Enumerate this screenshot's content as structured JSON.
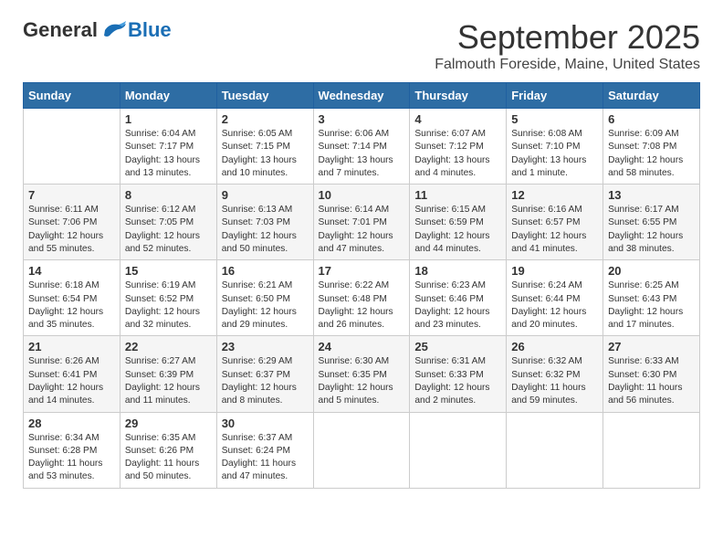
{
  "logo": {
    "general": "General",
    "blue": "Blue"
  },
  "title": "September 2025",
  "subtitle": "Falmouth Foreside, Maine, United States",
  "weekdays": [
    "Sunday",
    "Monday",
    "Tuesday",
    "Wednesday",
    "Thursday",
    "Friday",
    "Saturday"
  ],
  "weeks": [
    [
      {
        "day": "",
        "info": ""
      },
      {
        "day": "1",
        "info": "Sunrise: 6:04 AM\nSunset: 7:17 PM\nDaylight: 13 hours\nand 13 minutes."
      },
      {
        "day": "2",
        "info": "Sunrise: 6:05 AM\nSunset: 7:15 PM\nDaylight: 13 hours\nand 10 minutes."
      },
      {
        "day": "3",
        "info": "Sunrise: 6:06 AM\nSunset: 7:14 PM\nDaylight: 13 hours\nand 7 minutes."
      },
      {
        "day": "4",
        "info": "Sunrise: 6:07 AM\nSunset: 7:12 PM\nDaylight: 13 hours\nand 4 minutes."
      },
      {
        "day": "5",
        "info": "Sunrise: 6:08 AM\nSunset: 7:10 PM\nDaylight: 13 hours\nand 1 minute."
      },
      {
        "day": "6",
        "info": "Sunrise: 6:09 AM\nSunset: 7:08 PM\nDaylight: 12 hours\nand 58 minutes."
      }
    ],
    [
      {
        "day": "7",
        "info": "Sunrise: 6:11 AM\nSunset: 7:06 PM\nDaylight: 12 hours\nand 55 minutes."
      },
      {
        "day": "8",
        "info": "Sunrise: 6:12 AM\nSunset: 7:05 PM\nDaylight: 12 hours\nand 52 minutes."
      },
      {
        "day": "9",
        "info": "Sunrise: 6:13 AM\nSunset: 7:03 PM\nDaylight: 12 hours\nand 50 minutes."
      },
      {
        "day": "10",
        "info": "Sunrise: 6:14 AM\nSunset: 7:01 PM\nDaylight: 12 hours\nand 47 minutes."
      },
      {
        "day": "11",
        "info": "Sunrise: 6:15 AM\nSunset: 6:59 PM\nDaylight: 12 hours\nand 44 minutes."
      },
      {
        "day": "12",
        "info": "Sunrise: 6:16 AM\nSunset: 6:57 PM\nDaylight: 12 hours\nand 41 minutes."
      },
      {
        "day": "13",
        "info": "Sunrise: 6:17 AM\nSunset: 6:55 PM\nDaylight: 12 hours\nand 38 minutes."
      }
    ],
    [
      {
        "day": "14",
        "info": "Sunrise: 6:18 AM\nSunset: 6:54 PM\nDaylight: 12 hours\nand 35 minutes."
      },
      {
        "day": "15",
        "info": "Sunrise: 6:19 AM\nSunset: 6:52 PM\nDaylight: 12 hours\nand 32 minutes."
      },
      {
        "day": "16",
        "info": "Sunrise: 6:21 AM\nSunset: 6:50 PM\nDaylight: 12 hours\nand 29 minutes."
      },
      {
        "day": "17",
        "info": "Sunrise: 6:22 AM\nSunset: 6:48 PM\nDaylight: 12 hours\nand 26 minutes."
      },
      {
        "day": "18",
        "info": "Sunrise: 6:23 AM\nSunset: 6:46 PM\nDaylight: 12 hours\nand 23 minutes."
      },
      {
        "day": "19",
        "info": "Sunrise: 6:24 AM\nSunset: 6:44 PM\nDaylight: 12 hours\nand 20 minutes."
      },
      {
        "day": "20",
        "info": "Sunrise: 6:25 AM\nSunset: 6:43 PM\nDaylight: 12 hours\nand 17 minutes."
      }
    ],
    [
      {
        "day": "21",
        "info": "Sunrise: 6:26 AM\nSunset: 6:41 PM\nDaylight: 12 hours\nand 14 minutes."
      },
      {
        "day": "22",
        "info": "Sunrise: 6:27 AM\nSunset: 6:39 PM\nDaylight: 12 hours\nand 11 minutes."
      },
      {
        "day": "23",
        "info": "Sunrise: 6:29 AM\nSunset: 6:37 PM\nDaylight: 12 hours\nand 8 minutes."
      },
      {
        "day": "24",
        "info": "Sunrise: 6:30 AM\nSunset: 6:35 PM\nDaylight: 12 hours\nand 5 minutes."
      },
      {
        "day": "25",
        "info": "Sunrise: 6:31 AM\nSunset: 6:33 PM\nDaylight: 12 hours\nand 2 minutes."
      },
      {
        "day": "26",
        "info": "Sunrise: 6:32 AM\nSunset: 6:32 PM\nDaylight: 11 hours\nand 59 minutes."
      },
      {
        "day": "27",
        "info": "Sunrise: 6:33 AM\nSunset: 6:30 PM\nDaylight: 11 hours\nand 56 minutes."
      }
    ],
    [
      {
        "day": "28",
        "info": "Sunrise: 6:34 AM\nSunset: 6:28 PM\nDaylight: 11 hours\nand 53 minutes."
      },
      {
        "day": "29",
        "info": "Sunrise: 6:35 AM\nSunset: 6:26 PM\nDaylight: 11 hours\nand 50 minutes."
      },
      {
        "day": "30",
        "info": "Sunrise: 6:37 AM\nSunset: 6:24 PM\nDaylight: 11 hours\nand 47 minutes."
      },
      {
        "day": "",
        "info": ""
      },
      {
        "day": "",
        "info": ""
      },
      {
        "day": "",
        "info": ""
      },
      {
        "day": "",
        "info": ""
      }
    ]
  ]
}
